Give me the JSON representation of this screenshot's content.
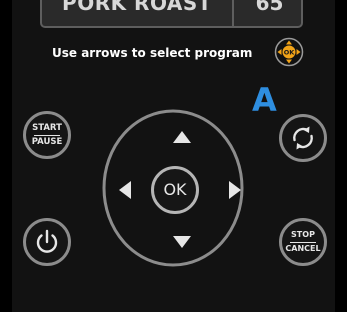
{
  "display": {
    "program_name": "PORK ROAST",
    "program_time": "65"
  },
  "instruction": "Use arrows to select program",
  "callout_label": "A",
  "buttons": {
    "start_pause": {
      "top": "START",
      "bottom": "PAUSE"
    },
    "stop_cancel": {
      "top": "STOP",
      "bottom": "CANCEL"
    }
  },
  "dpad": {
    "ok_label": "OK"
  },
  "mini_dpad": {
    "ok_label": "OK"
  },
  "icons": {
    "power": "power-icon",
    "cycle": "cycle-icon",
    "arrow_up": "arrow-up-icon",
    "arrow_down": "arrow-down-icon",
    "arrow_left": "arrow-left-icon",
    "arrow_right": "arrow-right-icon"
  },
  "colors": {
    "callout": "#2e8ee0",
    "mini_dpad_accent": "#f2a418",
    "button_ring": "#8c8c8c",
    "text": "#e6e6e6"
  }
}
